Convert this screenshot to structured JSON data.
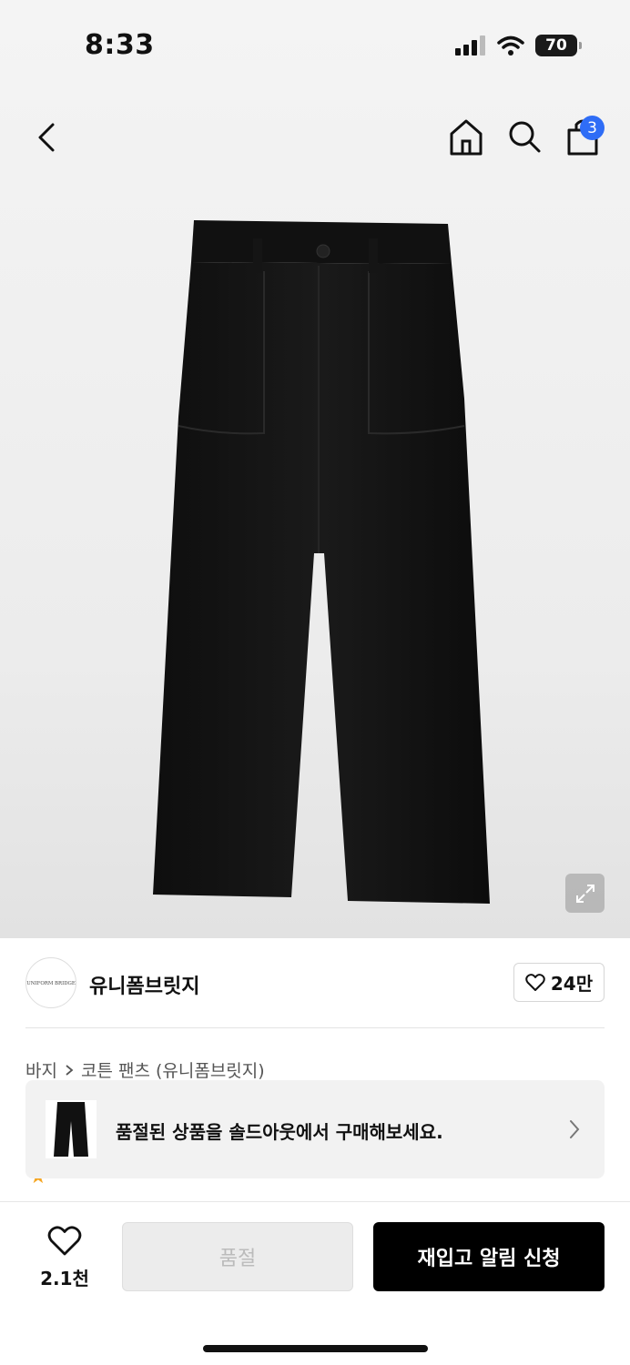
{
  "status": {
    "time": "8:33",
    "battery": "70"
  },
  "nav": {
    "cart_count": "3"
  },
  "brand": {
    "name": "유니폼브릿지",
    "logo_text": "UNIFORM BRIDGE",
    "likes": "24만"
  },
  "breadcrumb": {
    "category": "바지",
    "product": "코튼 팬츠 (유니폼브릿지)"
  },
  "soldout_banner": {
    "text": "품절된 상품을 솔드아웃에서 구매해보세요."
  },
  "bottom": {
    "wish_count": "2.1천",
    "soldout_label": "품절",
    "restock_label": "재입고 알림 신청"
  },
  "colors": {
    "badge": "#2f6df6",
    "star": "#f5a623",
    "primary_button": "#000000"
  }
}
